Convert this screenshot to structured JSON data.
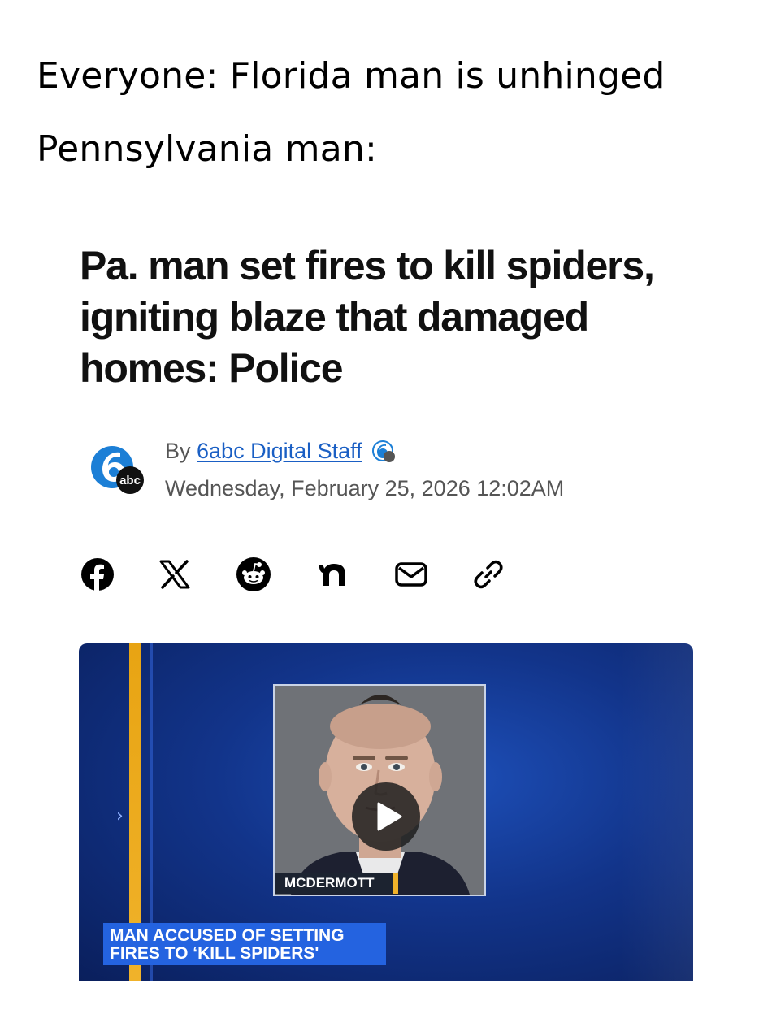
{
  "meme": {
    "line1": "Everyone: Florida man is unhinged",
    "line2": "Pennsylvania man:"
  },
  "article": {
    "headline": "Pa. man set fires to kill spiders, igniting blaze that damaged homes: Police",
    "by_prefix": "By ",
    "author": "6abc Digital Staff",
    "date": "Wednesday, February 25, 2026 12:02AM",
    "logo_text": "abc"
  },
  "share": [
    "facebook-icon",
    "x-icon",
    "reddit-icon",
    "nextdoor-icon",
    "email-icon",
    "link-icon"
  ],
  "video": {
    "nameplate": "MCDERMOTT",
    "lower_third": "MAN ACCUSED OF SETTING FIRES TO ‘KILL SPIDERS'",
    "accent_color": "#f0b22a",
    "bg_color": "#12348a"
  }
}
